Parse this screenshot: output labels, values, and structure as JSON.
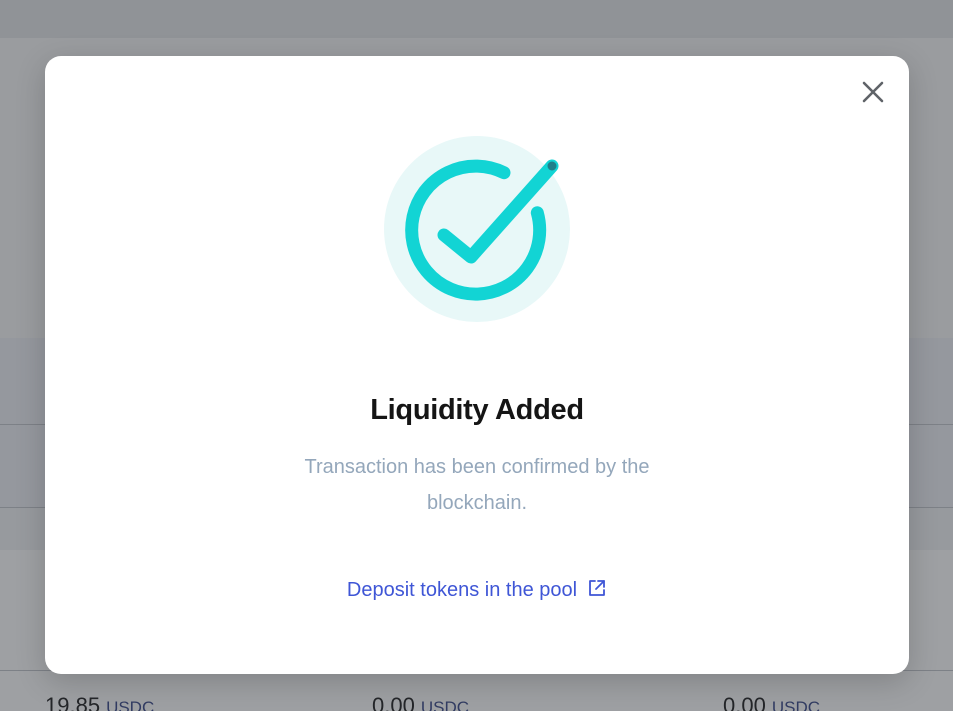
{
  "background": {
    "amounts": [
      {
        "value": "19.85",
        "unit": "USDC"
      },
      {
        "value": "0.00",
        "unit": "USDC"
      },
      {
        "value": "0.00",
        "unit": "USDC"
      }
    ]
  },
  "modal": {
    "title": "Liquidity Added",
    "description": "Transaction has been confirmed by the blockchain.",
    "link_label": "Deposit tokens in the pool",
    "close_icon": "close-icon",
    "status_icon": "check-circle-icon",
    "link_icon": "external-link-icon"
  },
  "colors": {
    "accent": "#12d4d4",
    "accent_bg": "#e8f8f8",
    "link": "#3f56d6",
    "muted_text": "#94a7bb"
  }
}
